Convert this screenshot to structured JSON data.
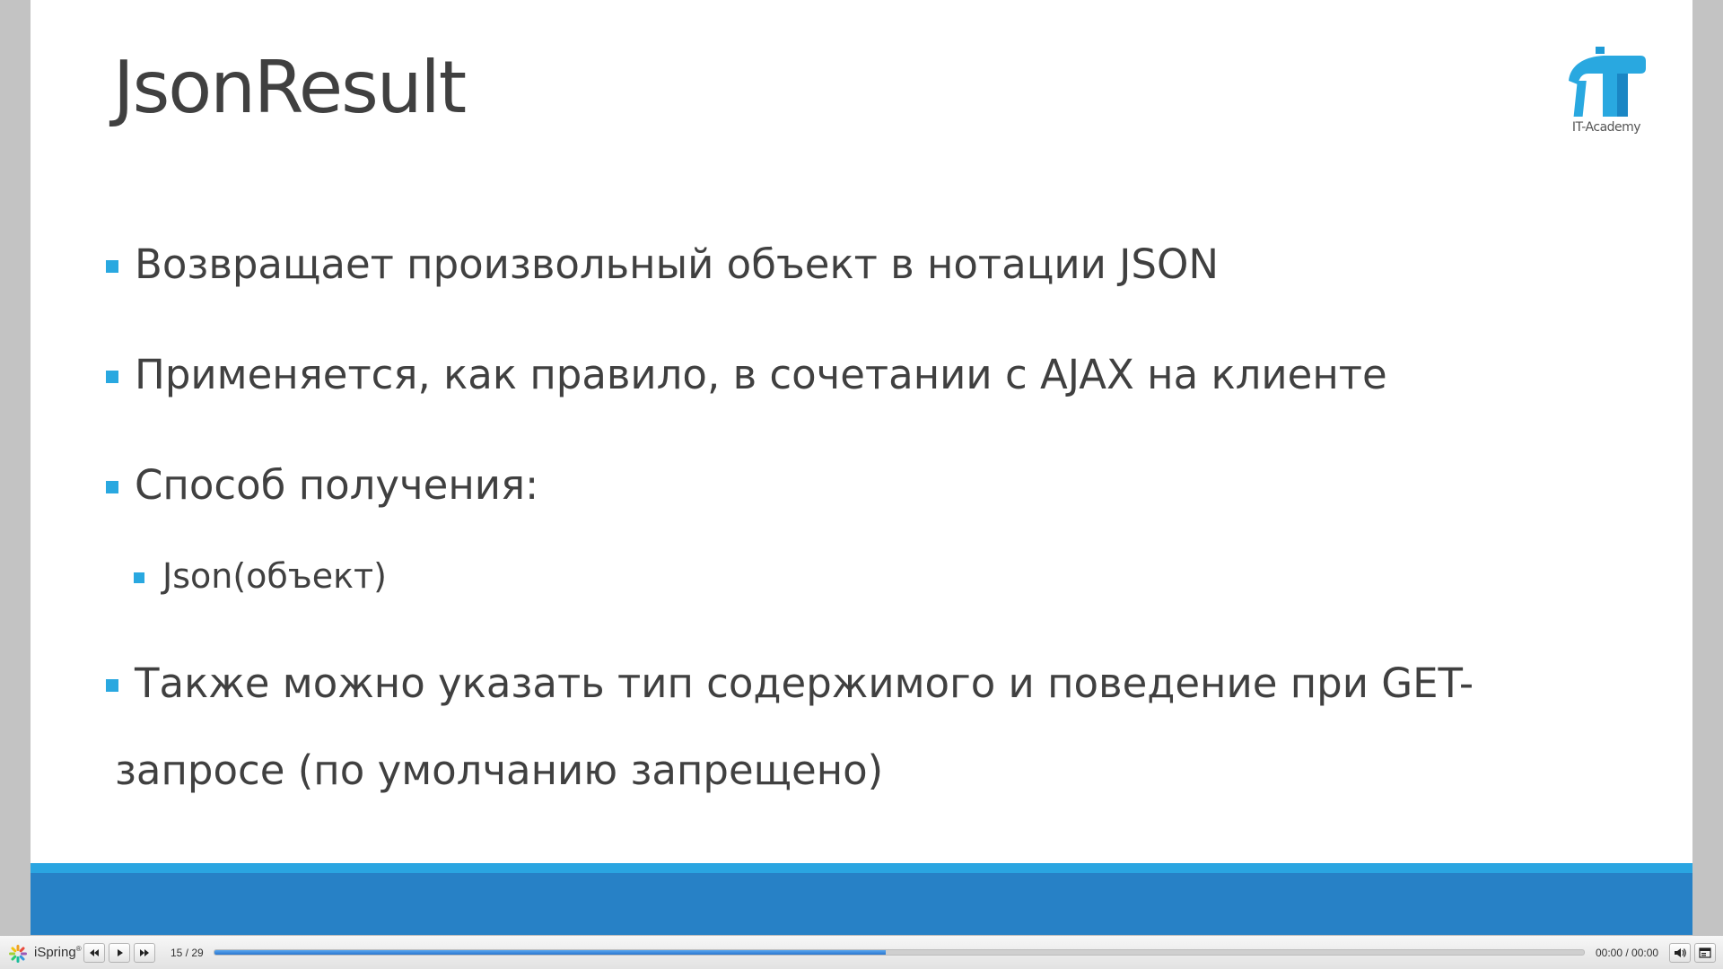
{
  "slide": {
    "title": "JsonResult",
    "logo_text": "IT-Academy",
    "bullets": [
      "Возвращает произвольный объект в нотации JSON",
      "Применяется, как правило, в сочетании с AJAX на клиенте",
      "Способ получения:"
    ],
    "sub_bullet": "Json(объект)",
    "last_bullet_line1": "Также можно указать тип содержимого и поведение при GET-",
    "last_bullet_line2": "запросе (по умолчанию запрещено)",
    "colors": {
      "bullet_square": "#29a8e0",
      "footer_thin": "#2aa5e1",
      "footer_band": "#2781c6",
      "text": "#404040"
    }
  },
  "player": {
    "brand": "iSpring",
    "brand_mark": "®",
    "slide_counter": "15 / 29",
    "current_slide": 15,
    "total_slides": 29,
    "time_display": "00:00 / 00:00",
    "progress_fraction": 0.49,
    "icons": {
      "prev": "rewind-icon",
      "play": "play-icon",
      "next": "fast-forward-icon",
      "volume": "volume-icon",
      "menu": "outline-menu-icon"
    }
  }
}
